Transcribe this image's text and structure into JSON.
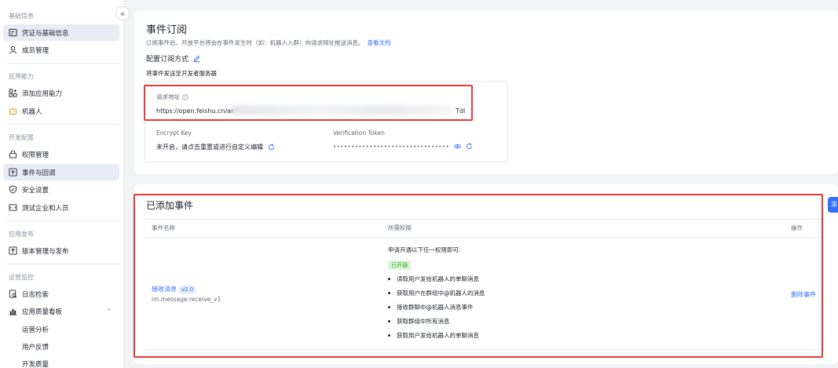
{
  "sidebar": {
    "groups": [
      {
        "title": "基础信息",
        "items": [
          {
            "label": "凭证与基础信息",
            "icon": "credential-icon"
          },
          {
            "label": "成员管理",
            "icon": "user-icon"
          }
        ]
      },
      {
        "title": "应用能力",
        "items": [
          {
            "label": "添加应用能力",
            "icon": "add-capability-icon"
          },
          {
            "label": "机器人",
            "icon": "robot-icon"
          }
        ]
      },
      {
        "title": "开发配置",
        "items": [
          {
            "label": "权限管理",
            "icon": "lock-icon"
          },
          {
            "label": "事件与回调",
            "icon": "event-icon"
          },
          {
            "label": "安全设置",
            "icon": "shield-icon"
          },
          {
            "label": "测试企业和人员",
            "icon": "test-icon"
          }
        ]
      },
      {
        "title": "应用发布",
        "items": [
          {
            "label": "版本管理与发布",
            "icon": "upload-icon"
          }
        ]
      },
      {
        "title": "运营监控",
        "items": [
          {
            "label": "日志检索",
            "icon": "log-icon"
          },
          {
            "label": "应用质量看板",
            "icon": "dashboard-icon"
          }
        ],
        "subitems": [
          "运营分析",
          "用户反馈",
          "开发质量"
        ]
      }
    ],
    "collapse_glyph": "«"
  },
  "subscription": {
    "title": "事件订阅",
    "description": "订阅事件后，开放平台将会在事件发生时（如：机器人入群）向请求网址推送消息。",
    "doc_link": "查看文档",
    "method_label": "配置订阅方式",
    "method_value": "将事件发送至开发者服务器",
    "request_url_label": "请求地址",
    "request_url_prefix": "https://open.feishu.cn/an",
    "request_url_suffix": "Tdl",
    "encrypt_key_label": "Encrypt Key",
    "encrypt_key_value": "未开启，请点击重置或进行自定义编辑",
    "verification_token_label": "Verification Token",
    "verification_token_value": "••••••••••••••••••••••••••••••••"
  },
  "events": {
    "title": "已添加事件",
    "add_button": "添",
    "columns": [
      "事件名称",
      "所需权限",
      "操作"
    ],
    "rows": [
      {
        "name": "接收消息",
        "version": "v2.0",
        "key": "im.message.receive_v1",
        "permission_hint": "申请开通以下任一权限即可:",
        "status": "已开通",
        "permissions": [
          "读取用户发给机器人的单聊消息",
          "获取用户在群组中@机器人的消息",
          "接收群聊中@机器人消息事件",
          "获取群组中所有消息",
          "获取用户发给机器人的单聊消息"
        ],
        "action": "删除事件"
      }
    ]
  },
  "colors": {
    "accent": "#3370ff",
    "highlight": "#e53935",
    "active_bg": "#e8ecf6"
  }
}
